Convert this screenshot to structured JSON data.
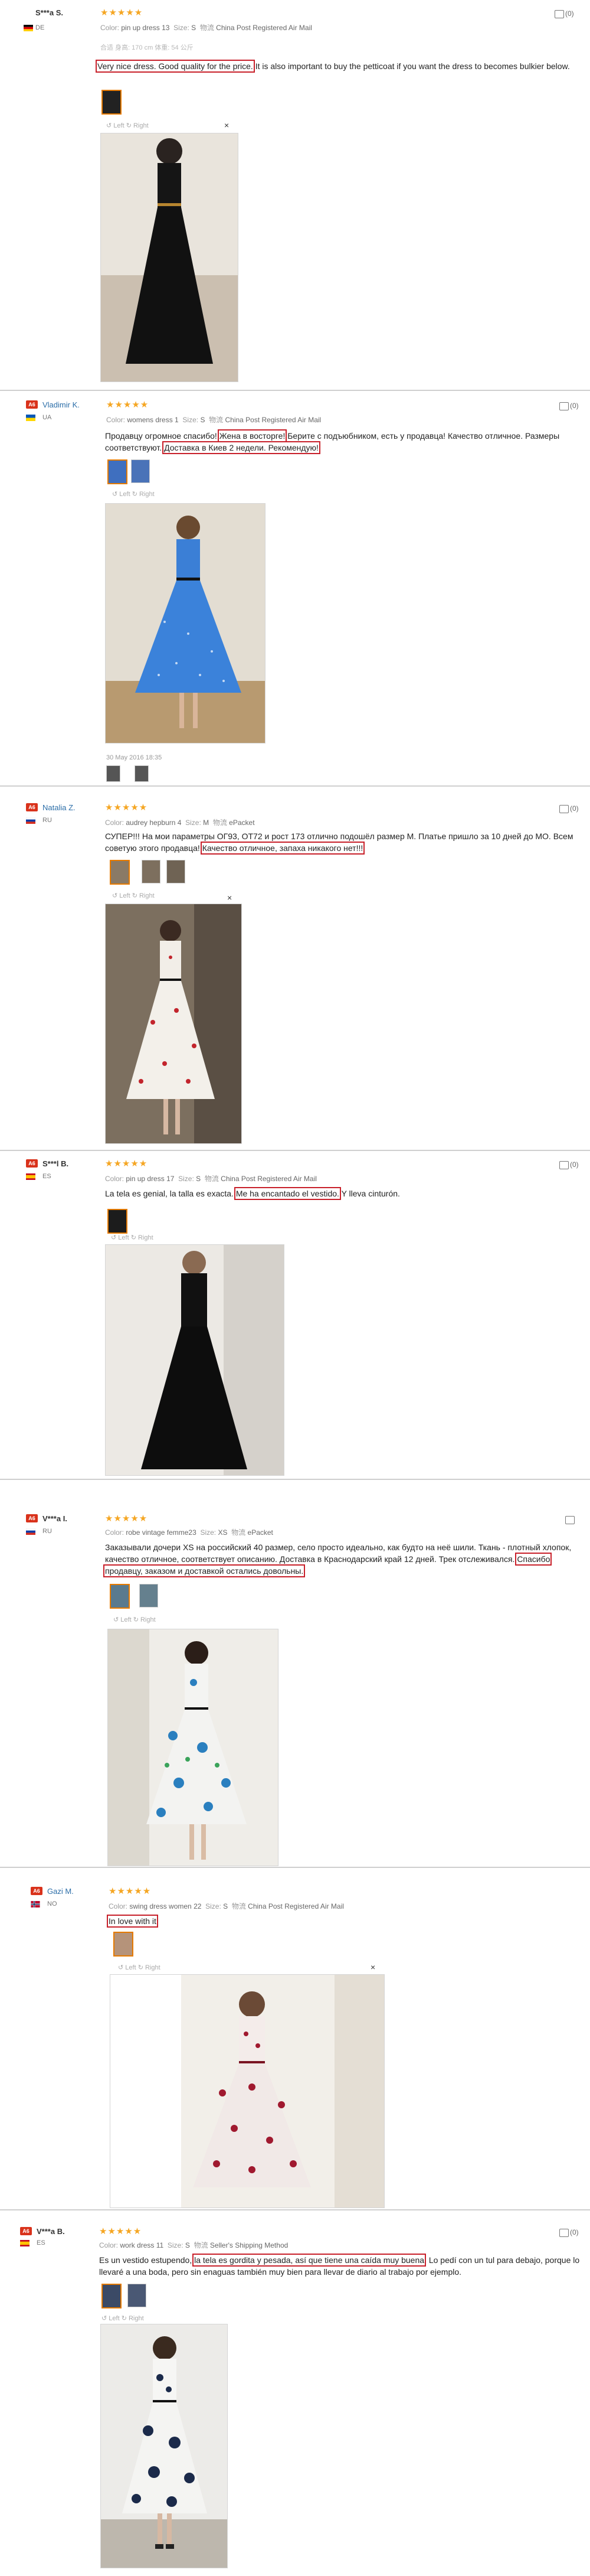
{
  "labels": {
    "color": "Color:",
    "size": "Size:",
    "shipping_cn": "物流",
    "rotate_left": "Left",
    "rotate_right": "Right",
    "close": "×"
  },
  "colors": {
    "star": "#f5a623",
    "highlight_box": "#c8202a",
    "username_link": "#2c6ea8",
    "badge": "#d9321b"
  },
  "reviews": [
    {
      "user": "S***a S.",
      "country": "DE",
      "stars": "★★★★★",
      "color": "pin up dress 13",
      "size": "S",
      "shipping": "China Post Registered Air Mail",
      "extra": "合适   身高: 170 cm   体重: 54 公斤",
      "text_hl": "Very nice dress. Good quality for the price.",
      "text_rest": " It is also important to buy the petticoat if you want the dress to becomes bulkier below.",
      "likes": "(0)"
    },
    {
      "user": "Vladimir K.",
      "country": "UA",
      "stars": "★★★★★",
      "color": "womens dress 1",
      "size": "S",
      "shipping": "China Post Registered Air Mail",
      "text_a": "Продавцу огромное спасибо! ",
      "text_hl1": "Жена в восторге!",
      "text_b": " Берите с подъюбником, есть у продавца! Качество отличное. Размеры соответствуют. ",
      "text_hl2": "Доставка в Киев 2 недели. Рекомендую!",
      "date": "30 May 2016 18:35",
      "likes": "(0)"
    },
    {
      "user": "Natalia Z.",
      "country": "RU",
      "stars": "★★★★★",
      "color": "audrey hepburn 4",
      "size": "M",
      "shipping": "ePacket",
      "text_a": "СУПЕР!!! На мои параметры ОГ93, ОТ72 и рост 173 отлично подошёл размер M. Платье пришло за 10 дней до МО. Всем советую этого продавца! ",
      "text_hl": "Качество отличное, запаха никакого нет!!!",
      "likes": "(0)"
    },
    {
      "user": "S***l B.",
      "country": "ES",
      "stars": "★★★★★",
      "color": "pin up dress 17",
      "size": "S",
      "shipping": "China Post Registered Air Mail",
      "text_a": "La tela es genial, la talla es exacta. ",
      "text_hl": "Me ha encantado el vestido.",
      "text_b": " Y lleva cinturón.",
      "likes": "(0)"
    },
    {
      "user": "V***a I.",
      "country": "RU",
      "stars": "★★★★★",
      "color": "robe vintage femme23",
      "size": "XS",
      "shipping": "ePacket",
      "text_a": "Заказывали дочери XS на российский 40 размер, село просто идеально, как будто на неё шили. Ткань - плотный хлопок, качество отличное, соответствует описанию. Доставка в Краснодарский край 12 дней. Трек отслеживался. ",
      "text_hl": "Спасибо продавцу, заказом и доставкой остались довольны."
    },
    {
      "user": "Gazi M.",
      "country": "NO",
      "stars": "★★★★★",
      "color": "swing dress women 22",
      "size": "S",
      "shipping": "China Post Registered Air Mail",
      "text_hl": "In love with it"
    },
    {
      "user": "V***a B.",
      "country": "ES",
      "stars": "★★★★★",
      "color": "work dress 11",
      "size": "S",
      "shipping": "Seller's Shipping Method",
      "text_a": "Es un vestido estupendo, ",
      "text_hl": "la tela es gordita y pesada, así que tiene una caída muy buena",
      "text_b": ". Lo pedí con un tul para debajo, porque lo llevaré a una boda, pero sin enaguas también muy bien para llevar de diario al trabajo por ejemplo.",
      "likes": "(0)"
    }
  ]
}
